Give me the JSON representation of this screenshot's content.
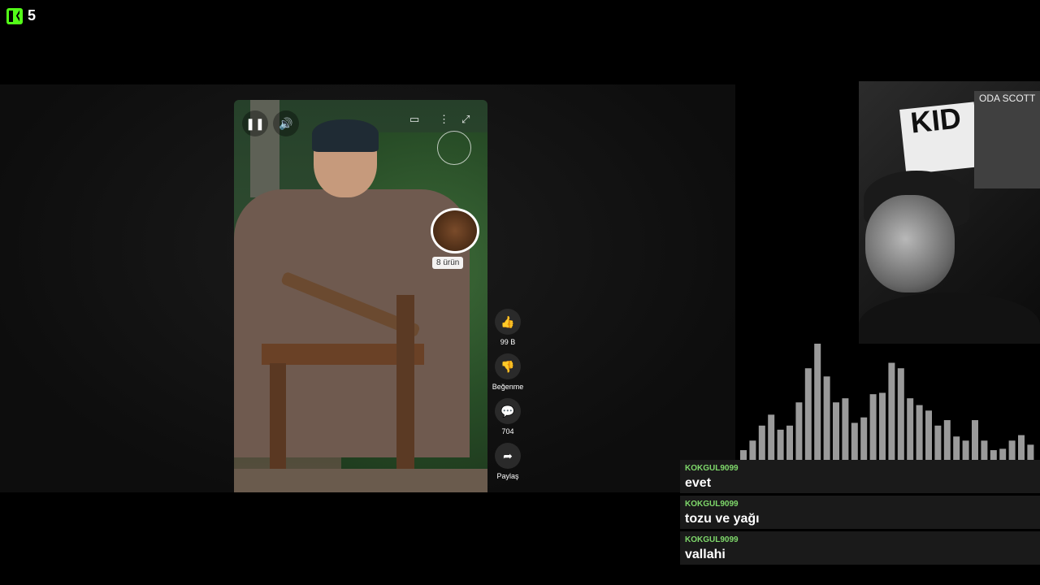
{
  "badge": {
    "count": "5",
    "logo_icon": "kick-logo-icon",
    "accent": "#53fc18"
  },
  "video": {
    "controls": {
      "pause_icon": "pause-icon",
      "volume_icon": "volume-icon",
      "fullscreen_icon": "expand-icon",
      "more_icon": "more-vertical-icon",
      "captions_icon": "captions-icon"
    },
    "product_tag": "8 ürün"
  },
  "actions": {
    "like": {
      "icon": "thumb-up-icon",
      "label": "99 B"
    },
    "dislike": {
      "icon": "thumb-down-icon",
      "label": "Beğenme"
    },
    "comments": {
      "icon": "comment-icon",
      "label": "704"
    },
    "share": {
      "icon": "share-icon",
      "label": "Paylaş"
    }
  },
  "webcam": {
    "poster_kid": "KID",
    "poster_scott": "ODA SCOTT"
  },
  "audio_levels": [
    0.22,
    0.29,
    0.4,
    0.48,
    0.37,
    0.4,
    0.57,
    0.82,
    1.0,
    0.76,
    0.57,
    0.6,
    0.42,
    0.46,
    0.63,
    0.64,
    0.86,
    0.82,
    0.6,
    0.55,
    0.51,
    0.4,
    0.44,
    0.32,
    0.29,
    0.44,
    0.29,
    0.22,
    0.23,
    0.29,
    0.33,
    0.26
  ],
  "chat": [
    {
      "user": "KOKGUL9099",
      "text": "evet"
    },
    {
      "user": "KOKGUL9099",
      "text": "tozu ve yağı"
    },
    {
      "user": "KOKGUL9099",
      "text": "vallahi"
    }
  ],
  "colors": {
    "chat_user": "#7fd96b",
    "chat_bg": "#1a1a1a",
    "viz_bar": "#9a9a9a"
  }
}
